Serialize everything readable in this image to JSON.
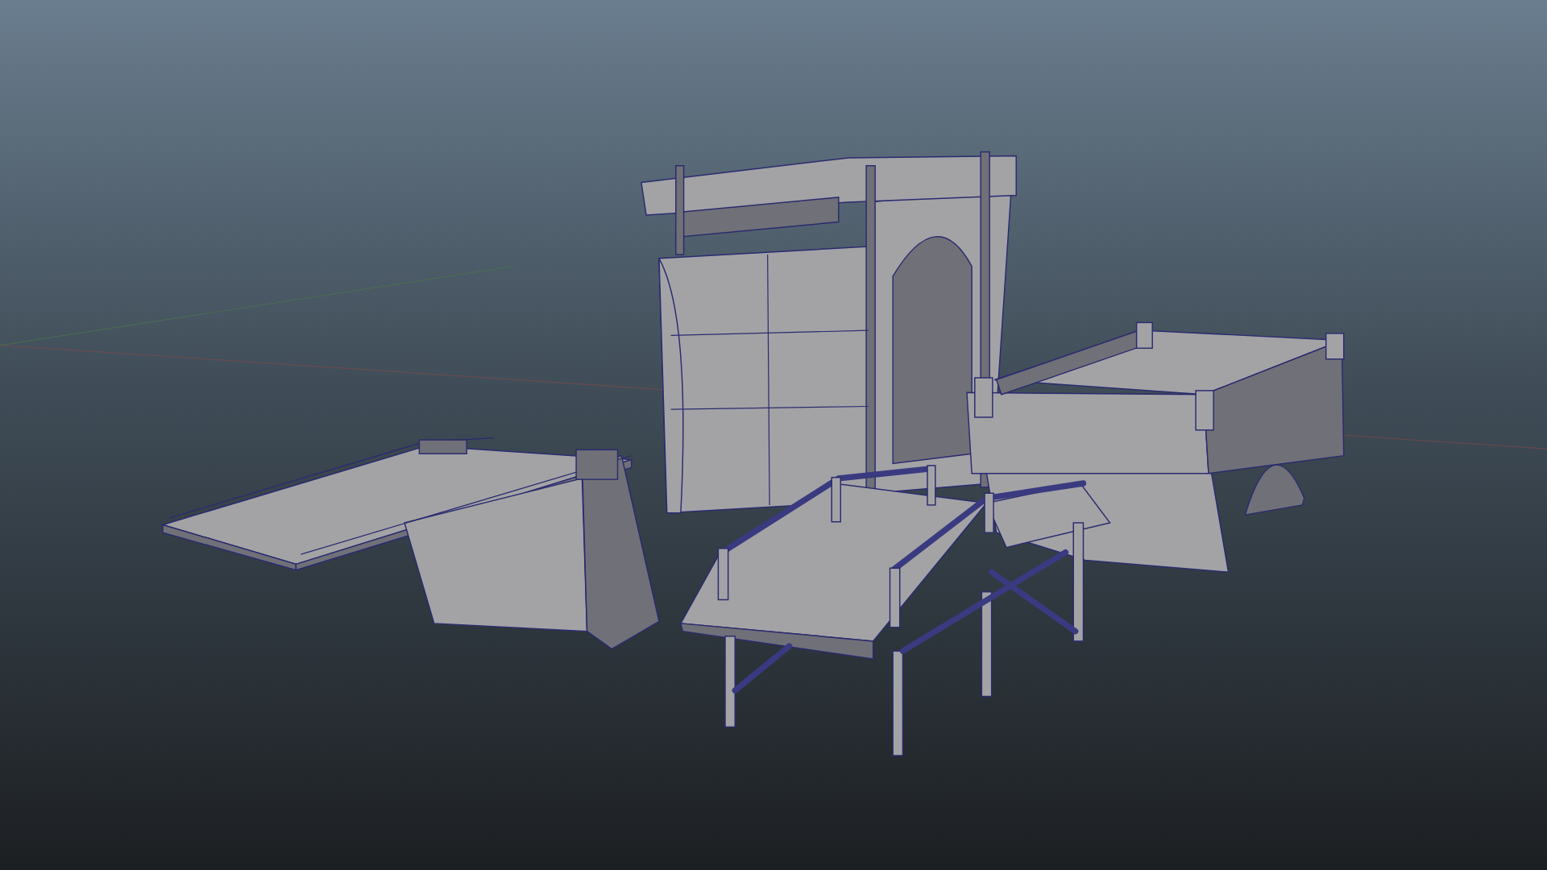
{
  "viewport": {
    "objects": [
      {
        "kind": "ramp"
      },
      {
        "kind": "tower"
      },
      {
        "kind": "arch"
      },
      {
        "kind": "walkway"
      }
    ]
  }
}
